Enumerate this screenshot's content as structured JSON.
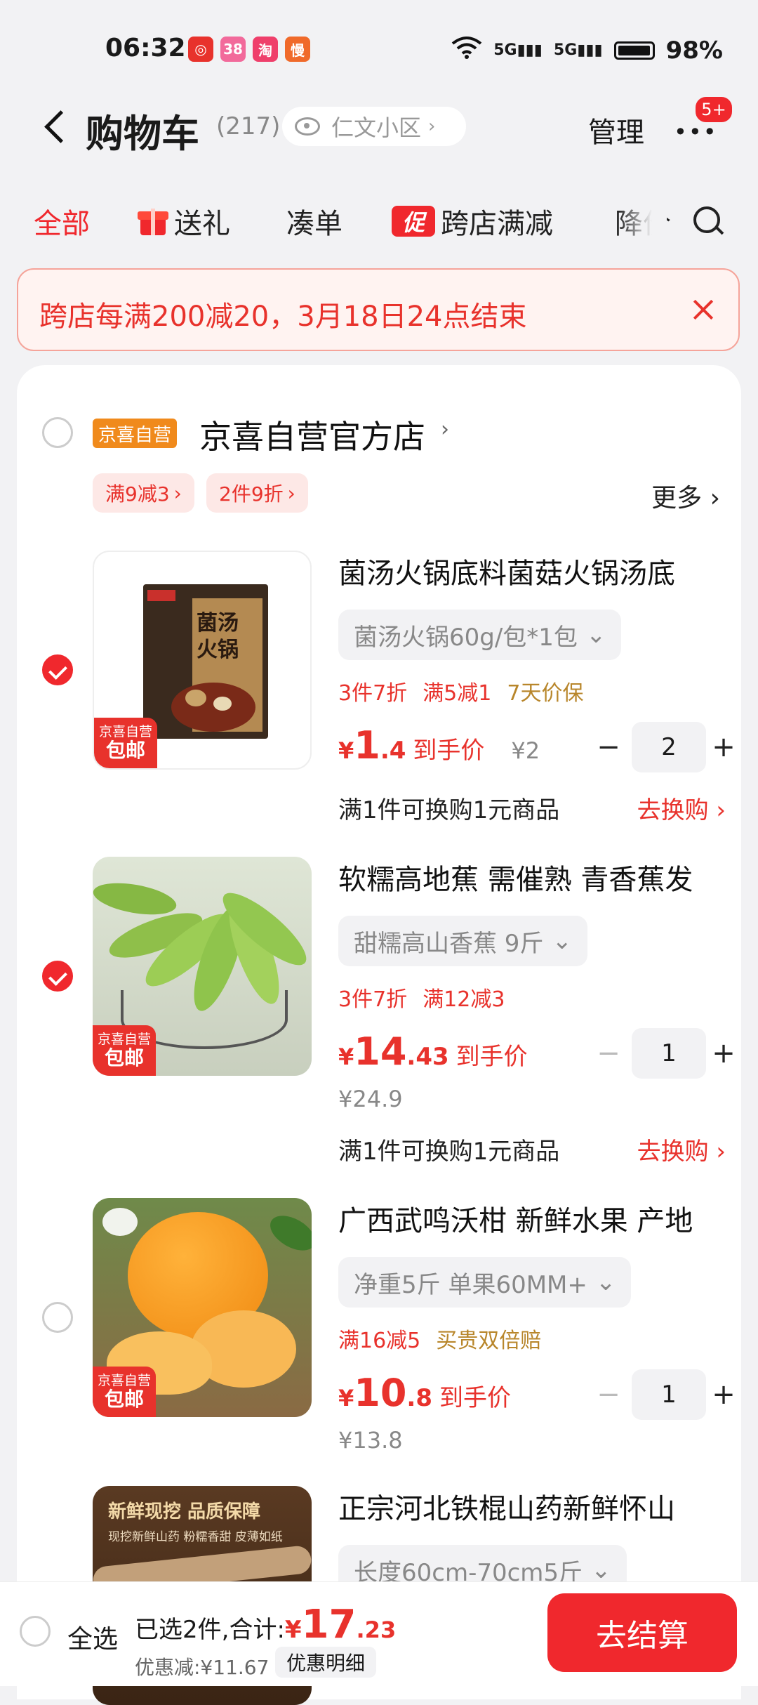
{
  "status": {
    "time": "06:32",
    "battery": "98%",
    "signal1": "5G",
    "signal2": "5G",
    "notifs": [
      {
        "label": "◎",
        "color": "#e8322c"
      },
      {
        "label": "38",
        "color": "#f26a9b"
      },
      {
        "label": "淘",
        "color": "#ef3f6b"
      },
      {
        "label": "慢",
        "color": "#f06a2a"
      }
    ]
  },
  "header": {
    "title": "购物车",
    "count": "(217)",
    "location": "仁文小区",
    "manage": "管理",
    "badge": "5+"
  },
  "tabs": [
    "全部",
    "送礼",
    "凑单",
    "跨店满减",
    "降价"
  ],
  "promo_tag": "促",
  "banner": {
    "text": "跨店每满200减20，3月18日24点结束"
  },
  "store": {
    "badge": "京喜自营",
    "name": "京喜自营官方店",
    "coupons": [
      "满9减3",
      "2件9折"
    ],
    "more": "更多"
  },
  "items": [
    {
      "title": "菌汤火锅底料菌菇火锅汤底",
      "sku": "菌汤火锅60g/包*1包",
      "promos": [
        {
          "text": "3件7折",
          "tone": "red"
        },
        {
          "text": "满5减1",
          "tone": "red"
        },
        {
          "text": "7天价保",
          "tone": "gold"
        }
      ],
      "price_int": "1",
      "price_dec": ".4",
      "price_label": "到手价",
      "orig": "¥2",
      "qty": "2",
      "checked": true,
      "exchange": "满1件可换购1元商品",
      "exchange_link": "去换购 ›"
    },
    {
      "title": "软糯高地蕉 需催熟 青香蕉发",
      "sku": "甜糯高山香蕉 9斤",
      "promos": [
        {
          "text": "3件7折",
          "tone": "red"
        },
        {
          "text": "满12减3",
          "tone": "red"
        }
      ],
      "price_int": "14",
      "price_dec": ".43",
      "price_label": "到手价",
      "orig": "¥24.9",
      "qty": "1",
      "checked": true,
      "exchange": "满1件可换购1元商品",
      "exchange_link": "去换购 ›"
    },
    {
      "title": "广西武鸣沃柑 新鲜水果 产地",
      "sku": "净重5斤 单果60MM+",
      "promos": [
        {
          "text": "满16减5",
          "tone": "red"
        },
        {
          "text": "买贵双倍赔",
          "tone": "gold"
        }
      ],
      "price_int": "10",
      "price_dec": ".8",
      "price_label": "到手价",
      "orig": "¥13.8",
      "qty": "1",
      "checked": false
    },
    {
      "title": "正宗河北铁棍山药新鲜怀山",
      "sku": "长度60cm-70cm5斤",
      "checked": false,
      "thumb_text1": "新鲜现挖 品质保障",
      "thumb_text2": "现挖新鲜山药 粉糯香甜 皮薄如纸"
    }
  ],
  "thumb_tag": {
    "line1": "京喜自营",
    "line2": "包邮"
  },
  "hotpot_pack": {
    "brand": "菌汤",
    "line1": "菌汤",
    "line2": "火锅"
  },
  "bottom": {
    "select_all": "全选",
    "selected": "已选2件,合计:",
    "total_yen": "¥",
    "total_int": "17",
    "total_dec": ".23",
    "discount": "优惠减:¥11.67",
    "detail": "优惠明细",
    "checkout": "去结算"
  }
}
